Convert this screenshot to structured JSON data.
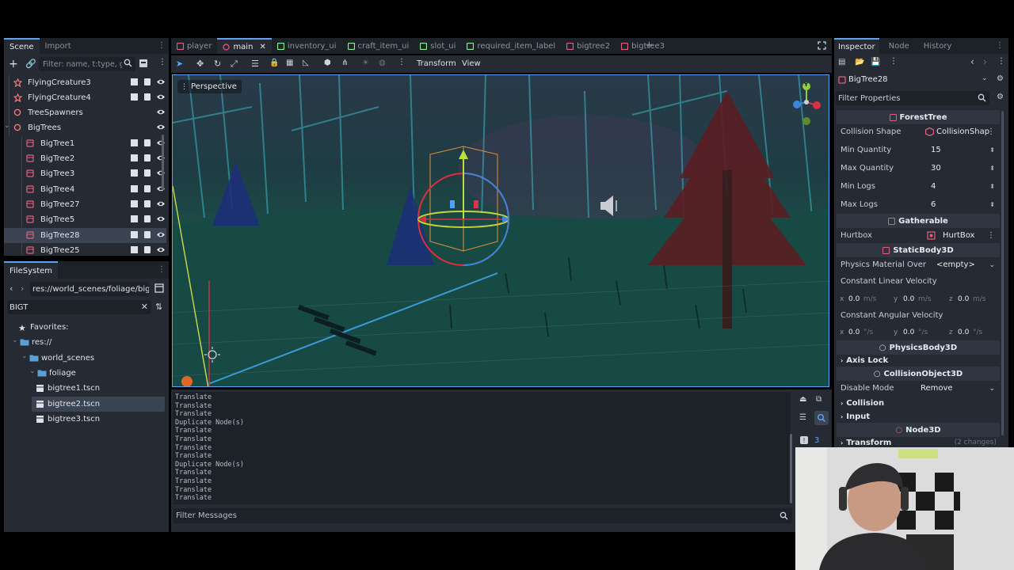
{
  "scene_dock": {
    "tabs": [
      "Scene",
      "Import"
    ],
    "filter_placeholder": "Filter: name, t:type, g:",
    "nodes": [
      {
        "label": "FlyingCreature3",
        "kind": "creature",
        "depth": 1,
        "tools": true
      },
      {
        "label": "FlyingCreature4",
        "kind": "creature",
        "depth": 1,
        "tools": true
      },
      {
        "label": "TreeSpawners",
        "kind": "node3d",
        "depth": 1,
        "tools": false
      },
      {
        "label": "BigTrees",
        "kind": "node3d",
        "depth": 1,
        "tools": false
      },
      {
        "label": "BigTree1",
        "kind": "scene",
        "depth": 2,
        "tools": true
      },
      {
        "label": "BigTree2",
        "kind": "scene",
        "depth": 2,
        "tools": true
      },
      {
        "label": "BigTree3",
        "kind": "scene",
        "depth": 2,
        "tools": true
      },
      {
        "label": "BigTree4",
        "kind": "scene",
        "depth": 2,
        "tools": true
      },
      {
        "label": "BigTree27",
        "kind": "scene",
        "depth": 2,
        "tools": true
      },
      {
        "label": "BigTree5",
        "kind": "scene",
        "depth": 2,
        "tools": true
      },
      {
        "label": "BigTree28",
        "kind": "scene",
        "depth": 2,
        "tools": true,
        "selected": true
      },
      {
        "label": "BigTree25",
        "kind": "scene",
        "depth": 2,
        "tools": true
      }
    ]
  },
  "filesystem": {
    "tab": "FileSystem",
    "path": "res://world_scenes/foliage/bigtr",
    "search": "BIGT",
    "items": [
      {
        "label": "Favorites:",
        "kind": "star"
      },
      {
        "label": "res://",
        "kind": "folder"
      },
      {
        "label": "world_scenes",
        "kind": "folder"
      },
      {
        "label": "foliage",
        "kind": "folder"
      },
      {
        "label": "bigtree1.tscn",
        "kind": "file"
      },
      {
        "label": "bigtree2.tscn",
        "kind": "file",
        "selected": true
      },
      {
        "label": "bigtree3.tscn",
        "kind": "file"
      }
    ]
  },
  "scene_tabs": [
    {
      "label": "player",
      "color": "#e0607e"
    },
    {
      "label": "main",
      "color": "#e0607e",
      "active": true
    },
    {
      "label": "inventory_ui",
      "color": "#8eef97"
    },
    {
      "label": "craft_item_ui",
      "color": "#8eef97"
    },
    {
      "label": "slot_ui",
      "color": "#8eef97"
    },
    {
      "label": "required_item_label",
      "color": "#8eef97"
    },
    {
      "label": "bigtree2",
      "color": "#e0607e"
    },
    {
      "label": "bigtree3",
      "color": "#e0607e"
    }
  ],
  "toolbar": {
    "transform_menu": "Transform",
    "view_menu": "View"
  },
  "viewport": {
    "perspective_label": "Perspective",
    "gizmo": {
      "x": "X",
      "y": "Y",
      "z": "Z"
    }
  },
  "output": {
    "lines": [
      "Translate",
      "Translate",
      "Translate",
      "Duplicate Node(s)",
      "Translate",
      "Translate",
      "Translate",
      "Translate",
      "Duplicate Node(s)",
      "Translate",
      "Translate",
      "Translate",
      "Translate"
    ],
    "filter_placeholder": "Filter Messages",
    "message_count": "3"
  },
  "inspector": {
    "tabs": [
      "Inspector",
      "Node",
      "History"
    ],
    "node_name": "BigTree28",
    "filter_placeholder": "Filter Properties",
    "sections": {
      "forest_tree": "ForestTree",
      "gatherable": "Gatherable",
      "static_body": "StaticBody3D",
      "physics_body": "PhysicsBody3D",
      "collision_object": "CollisionObject3D",
      "node3d": "Node3D"
    },
    "collision_shape": {
      "key": "Collision Shape",
      "value": "CollisionShap"
    },
    "min_quantity": {
      "key": "Min Quantity",
      "value": "15"
    },
    "max_quantity": {
      "key": "Max Quantity",
      "value": "30"
    },
    "min_logs": {
      "key": "Min Logs",
      "value": "4"
    },
    "max_logs": {
      "key": "Max Logs",
      "value": "6"
    },
    "hurtbox": {
      "key": "Hurtbox",
      "value": "HurtBox"
    },
    "physics_material": {
      "key": "Physics Material Over",
      "value": "<empty>"
    },
    "linear_velocity": {
      "key": "Constant Linear Velocity",
      "x": "0.0",
      "y": "0.0",
      "z": "0.0",
      "unit": "m/s"
    },
    "angular_velocity": {
      "key": "Constant Angular Velocity",
      "x": "0.0",
      "y": "0.0",
      "z": "0.0",
      "unit": "°/s"
    },
    "axis_lock": "Axis Lock",
    "disable_mode": {
      "key": "Disable Mode",
      "value": "Remove"
    },
    "collision": "Collision",
    "input": "Input",
    "transform": {
      "label": "Transform",
      "note": "(2 changes)"
    }
  },
  "colors": {
    "accent": "#5ea3f0",
    "scene_icon": "#e0607e",
    "node3d": "#fc7f7f",
    "panel": "#252a33",
    "viewport_tint": "#1f4e49"
  }
}
